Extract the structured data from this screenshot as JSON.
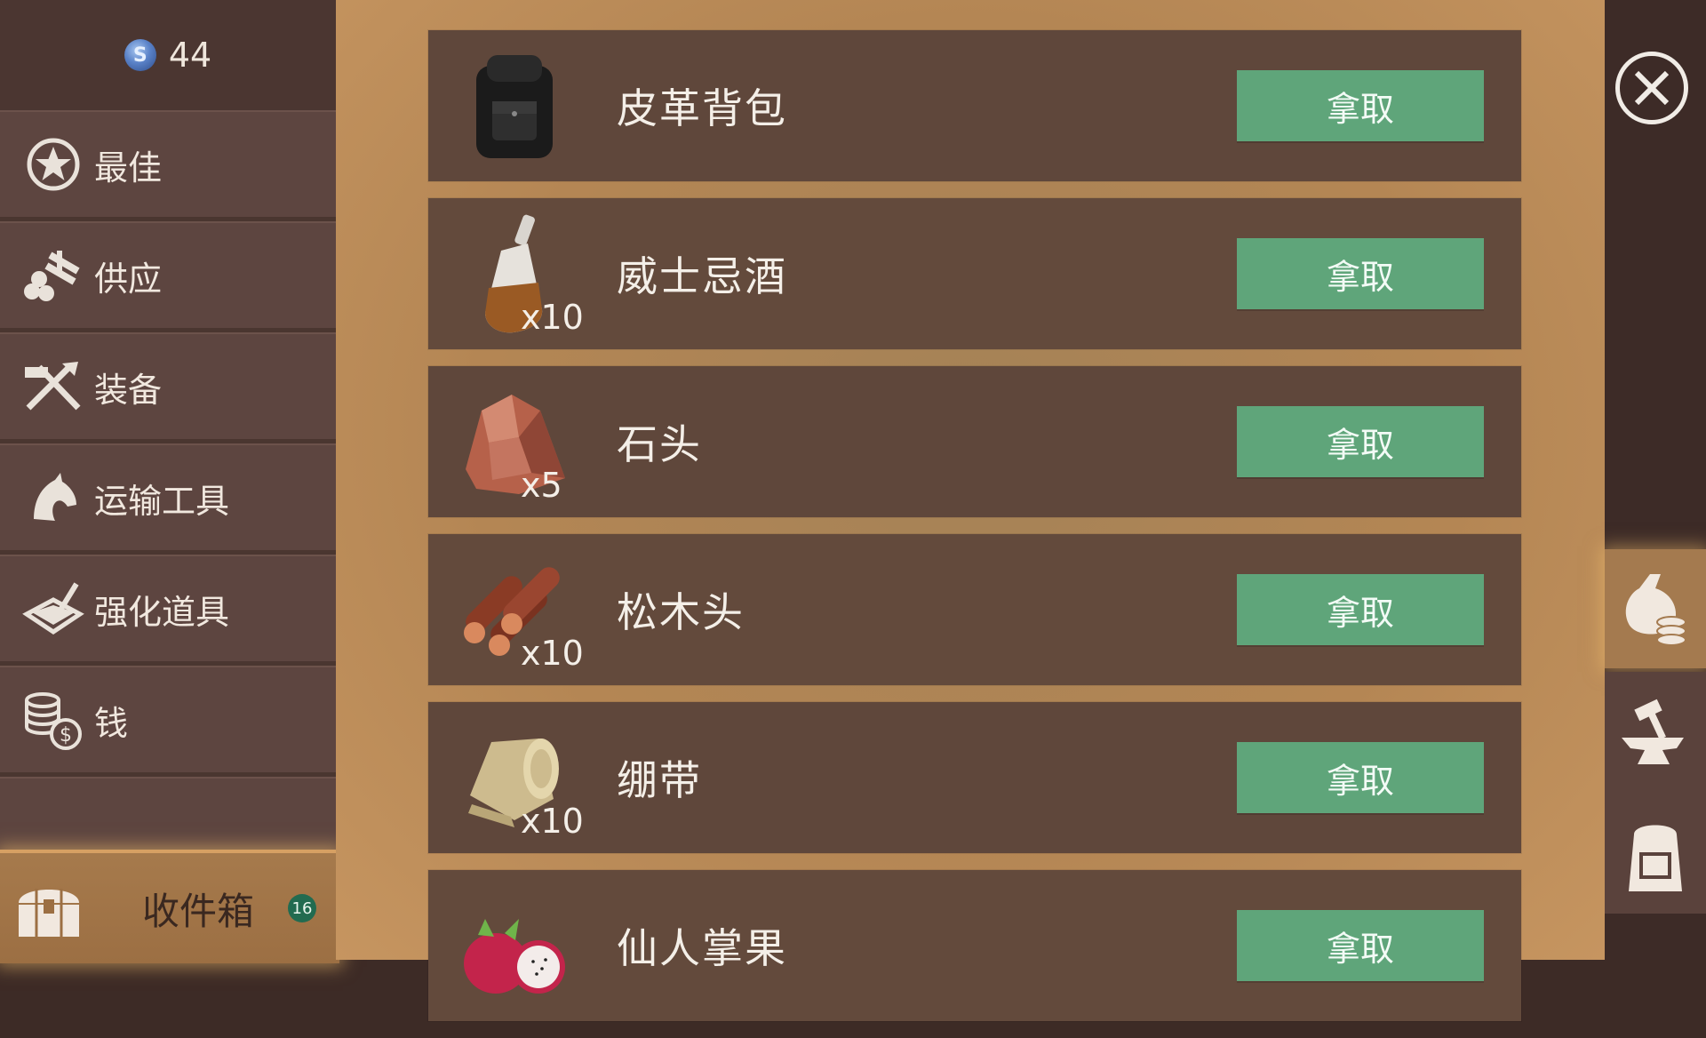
{
  "currency": {
    "amount": "44",
    "icon": "blue-gem-coin-icon"
  },
  "sidebar": {
    "items": [
      {
        "label": "最佳",
        "icon": "star-badge-icon"
      },
      {
        "label": "供应",
        "icon": "logs-supply-icon"
      },
      {
        "label": "装备",
        "icon": "crossed-tools-icon"
      },
      {
        "label": "运输工具",
        "icon": "horse-head-icon"
      },
      {
        "label": "强化道具",
        "icon": "book-quill-icon"
      },
      {
        "label": "钱",
        "icon": "coins-dollar-icon"
      }
    ],
    "inbox": {
      "label": "收件箱",
      "badge": "16",
      "icon": "treasure-chest-icon"
    }
  },
  "items": [
    {
      "name": "皮革背包",
      "qty": "",
      "button": "拿取",
      "icon": "leather-backpack-icon"
    },
    {
      "name": "威士忌酒",
      "qty": "x10",
      "button": "拿取",
      "icon": "whiskey-bottle-icon"
    },
    {
      "name": "石头",
      "qty": "x5",
      "button": "拿取",
      "icon": "stone-icon"
    },
    {
      "name": "松木头",
      "qty": "x10",
      "button": "拿取",
      "icon": "pine-logs-icon"
    },
    {
      "name": "绷带",
      "qty": "x10",
      "button": "拿取",
      "icon": "bandage-roll-icon"
    },
    {
      "name": "仙人掌果",
      "qty": "",
      "button": "拿取",
      "icon": "dragon-fruit-icon"
    }
  ],
  "rail": {
    "close_icon": "close-icon",
    "tabs": [
      "money-bag-coins-icon",
      "anvil-hammer-icon",
      "backpack-icon"
    ]
  },
  "colors": {
    "take_button": "#5fa57a",
    "badge": "#226b50",
    "main_bg": "#b48654"
  }
}
